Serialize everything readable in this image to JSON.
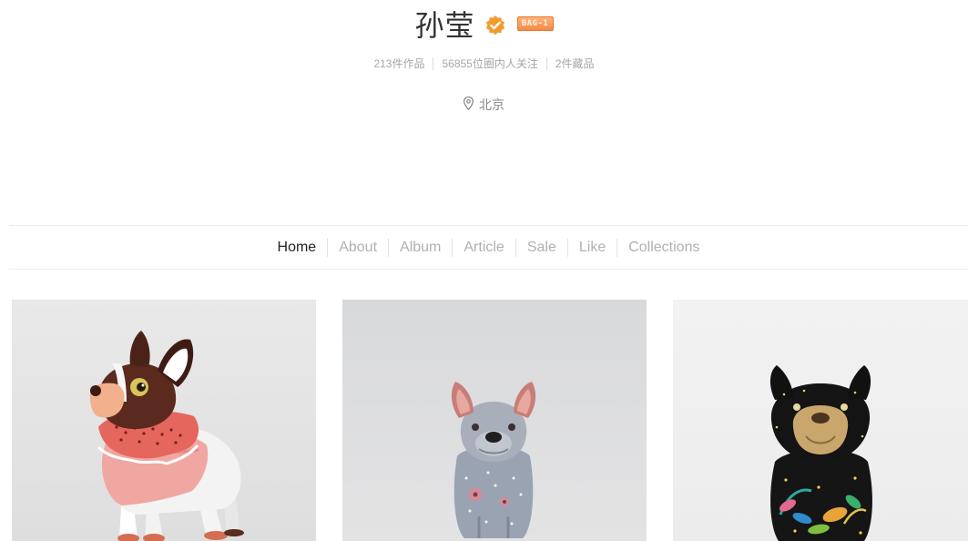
{
  "profile": {
    "name": "孙莹",
    "badge": "BAG-1",
    "stats": {
      "works": "213件作品",
      "followers": "56855位圈内人关注",
      "collections": "2件藏品"
    },
    "location": "北京"
  },
  "nav": {
    "tabs": [
      {
        "label": "Home",
        "active": true
      },
      {
        "label": "About",
        "active": false
      },
      {
        "label": "Album",
        "active": false
      },
      {
        "label": "Article",
        "active": false
      },
      {
        "label": "Sale",
        "active": false
      },
      {
        "label": "Like",
        "active": false
      },
      {
        "label": "Collections",
        "active": false
      }
    ]
  },
  "gallery": {
    "items": [
      {
        "subject": "pink-scarf-bulldog-figurine",
        "background": "#e7e7e7"
      },
      {
        "subject": "grey-floral-bulldog-figurine",
        "background": "#dadbdd"
      },
      {
        "subject": "black-botanical-bulldog-figurine",
        "background": "#f1f1f1"
      }
    ]
  },
  "colors": {
    "accent_orange": "#f39a2e",
    "text_dark": "#333333",
    "text_muted": "#a6a6a6"
  }
}
